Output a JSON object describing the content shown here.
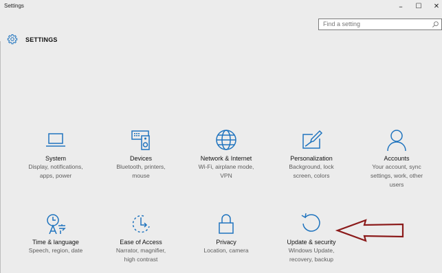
{
  "window": {
    "title": "Settings",
    "minimize": "–",
    "maximize": "☐",
    "close": "✕"
  },
  "header": {
    "title": "SETTINGS",
    "search_placeholder": "Find a setting"
  },
  "tiles": [
    {
      "icon": "laptop-icon",
      "label": "System",
      "desc": [
        "Display, notifications,",
        "apps, power"
      ]
    },
    {
      "icon": "devices-icon",
      "label": "Devices",
      "desc": [
        "Bluetooth, printers,",
        "mouse"
      ]
    },
    {
      "icon": "globe-icon",
      "label": "Network & Internet",
      "desc": [
        "Wi-Fi, airplane mode,",
        "VPN"
      ]
    },
    {
      "icon": "paint-icon",
      "label": "Personalization",
      "desc": [
        "Background, lock",
        "screen, colors"
      ]
    },
    {
      "icon": "person-icon",
      "label": "Accounts",
      "desc": [
        "Your account, sync",
        "settings, work, other",
        "users"
      ]
    },
    {
      "icon": "language-icon",
      "label": "Time & language",
      "desc": [
        "Speech, region, date"
      ]
    },
    {
      "icon": "ease-of-access-icon",
      "label": "Ease of Access",
      "desc": [
        "Narrator, magnifier,",
        "high contrast"
      ]
    },
    {
      "icon": "lock-icon",
      "label": "Privacy",
      "desc": [
        "Location, camera"
      ]
    },
    {
      "icon": "update-icon",
      "label": "Update & security",
      "desc": [
        "Windows Update,",
        "recovery, backup"
      ]
    }
  ],
  "colors": {
    "accent": "#1e73be",
    "background": "#ececec",
    "annotation_arrow": "#8b1a1a"
  }
}
